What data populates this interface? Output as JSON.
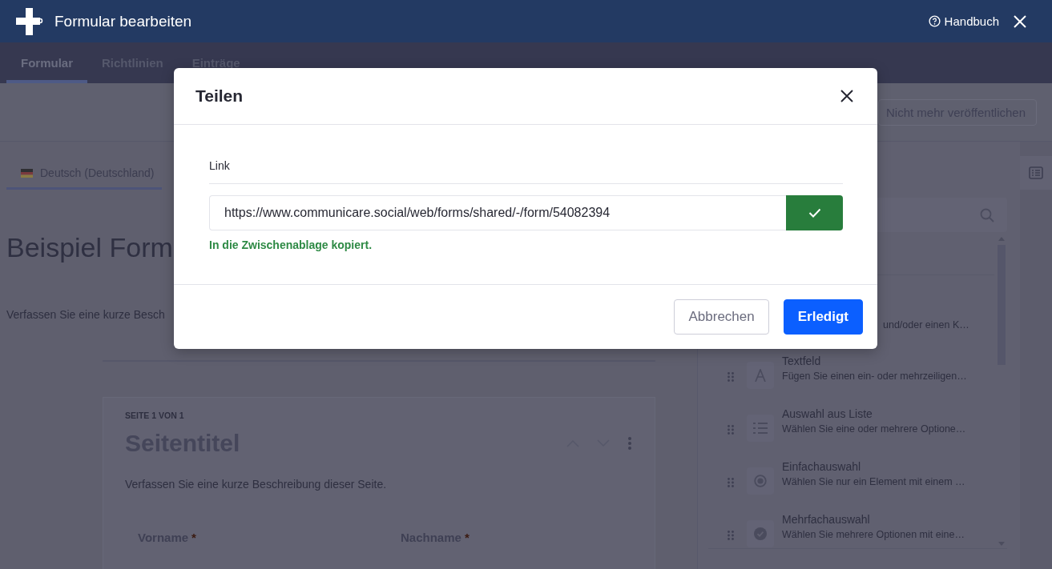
{
  "header": {
    "title": "Formular bearbeiten",
    "help_link": "Handbuch"
  },
  "tabs": [
    {
      "label": "Formular",
      "selected": true
    },
    {
      "label": "Richtlinien",
      "selected": false
    },
    {
      "label": "Einträge",
      "selected": false
    }
  ],
  "toolbar": {
    "unpublish_button": "Nicht mehr veröffentlichen"
  },
  "language_tab": {
    "label": "Deutsch (Deutschland)"
  },
  "form": {
    "title": "Beispiel Form",
    "description": "Verfassen Sie eine kurze Besch",
    "page": {
      "counter": "SEITE 1 VON 1",
      "title": "Seitentitel",
      "description": "Verfassen Sie eine kurze Beschreibung dieser Seite.",
      "fields": [
        {
          "label": "Vorname",
          "required_mark": "*"
        },
        {
          "label": "Nachname",
          "required_mark": "*"
        }
      ]
    }
  },
  "sidebar": {
    "items": [
      {
        "kind": "cut",
        "description": "und/oder einen K…"
      },
      {
        "kind": "text",
        "title": "Textfeld",
        "description": "Fügen Sie einen ein- oder mehrzeiligen…"
      },
      {
        "kind": "list",
        "title": "Auswahl aus Liste",
        "description": "Wählen Sie eine oder mehrere Optione…"
      },
      {
        "kind": "radio",
        "title": "Einfachauswahl",
        "description": "Wählen Sie nur ein Element mit einem …"
      },
      {
        "kind": "checkbox",
        "title": "Mehrfachauswahl",
        "description": "Wählen Sie mehrere Optionen mit eine…"
      }
    ]
  },
  "dialog": {
    "title": "Teilen",
    "link_label": "Link",
    "link_value": "https://www.communicare.social/web/forms/shared/-/form/54082394",
    "copied": true,
    "copied_message": "In die Zwischenablage kopiert.",
    "buttons": [
      {
        "label": "Abbrechen",
        "kind": "secondary"
      },
      {
        "label": "Erledigt",
        "kind": "primary"
      }
    ]
  }
}
